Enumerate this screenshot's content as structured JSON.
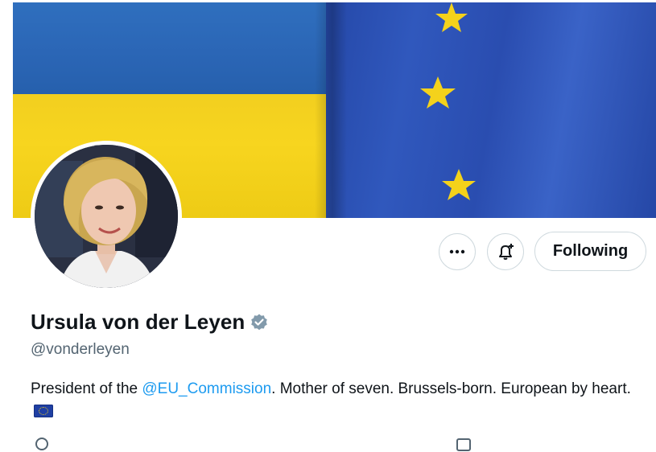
{
  "profile": {
    "display_name": "Ursula von der Leyen",
    "handle": "@vonderleyen",
    "bio_prefix": "President of the ",
    "bio_mention": "@EU_Commission",
    "bio_suffix": ". Mother of seven. Brussels-born. European by heart.",
    "bio_flag": "EU flag"
  },
  "actions": {
    "more_icon": "more-horizontal-icon",
    "notify_icon": "bell-plus-icon",
    "follow_label": "Following"
  },
  "colors": {
    "accent": "#1d9bf0",
    "text": "#0f1419",
    "secondary_text": "#536471",
    "border": "#cfd9de",
    "verified": "#829aab"
  }
}
